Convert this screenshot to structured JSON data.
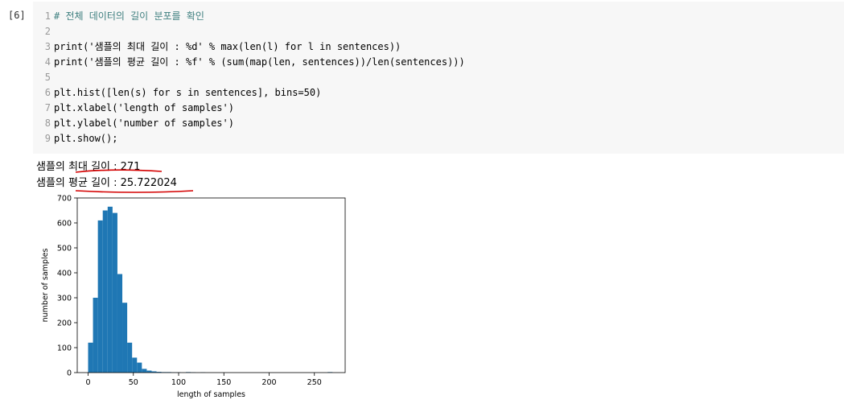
{
  "cell": {
    "prompt": "[6]",
    "lines": [
      {
        "no": "1",
        "text": "# 전체 데이터의 길이 분포를 확인",
        "cls": "c"
      },
      {
        "no": "2",
        "text": "",
        "cls": "fn"
      },
      {
        "no": "3",
        "text": "print('샘플의 최대 길이 : %d' % max(len(l) for l in sentences))",
        "cls": "fn"
      },
      {
        "no": "4",
        "text": "print('샘플의 평균 길이 : %f' % (sum(map(len, sentences))/len(sentences)))",
        "cls": "fn"
      },
      {
        "no": "5",
        "text": "",
        "cls": "fn"
      },
      {
        "no": "6",
        "text": "plt.hist([len(s) for s in sentences], bins=50)",
        "cls": "fn"
      },
      {
        "no": "7",
        "text": "plt.xlabel('length of samples')",
        "cls": "fn"
      },
      {
        "no": "8",
        "text": "plt.ylabel('number of samples')",
        "cls": "fn"
      },
      {
        "no": "9",
        "text": "plt.show();",
        "cls": "fn"
      }
    ]
  },
  "output": {
    "line1": "샘플의 최대 길이 : 271",
    "line2": "샘플의 평균 길이 : 25.722024"
  },
  "chart_data": {
    "type": "bar",
    "xlabel": "length of samples",
    "ylabel": "number of samples",
    "xlim": [
      -12,
      284
    ],
    "ylim": [
      0,
      700
    ],
    "xticks": [
      0,
      50,
      100,
      150,
      200,
      250
    ],
    "yticks": [
      0,
      100,
      200,
      300,
      400,
      500,
      600,
      700
    ],
    "bin_width": 5.4,
    "bins": [
      {
        "x": 0,
        "y": 120
      },
      {
        "x": 5.4,
        "y": 300
      },
      {
        "x": 10.8,
        "y": 610
      },
      {
        "x": 16.2,
        "y": 650
      },
      {
        "x": 21.6,
        "y": 665
      },
      {
        "x": 27,
        "y": 640
      },
      {
        "x": 32.4,
        "y": 395
      },
      {
        "x": 37.8,
        "y": 280
      },
      {
        "x": 43.2,
        "y": 120
      },
      {
        "x": 48.6,
        "y": 60
      },
      {
        "x": 54,
        "y": 40
      },
      {
        "x": 59.4,
        "y": 15
      },
      {
        "x": 64.8,
        "y": 8
      },
      {
        "x": 70.2,
        "y": 5
      },
      {
        "x": 75.6,
        "y": 3
      },
      {
        "x": 81,
        "y": 2
      },
      {
        "x": 86.4,
        "y": 2
      },
      {
        "x": 91.8,
        "y": 1
      },
      {
        "x": 97.2,
        "y": 1
      },
      {
        "x": 108,
        "y": 2
      },
      {
        "x": 113.4,
        "y": 1
      },
      {
        "x": 124.2,
        "y": 1
      },
      {
        "x": 264.6,
        "y": 2
      }
    ],
    "color": "#1f77b4"
  },
  "annotation_color": "#d40000"
}
